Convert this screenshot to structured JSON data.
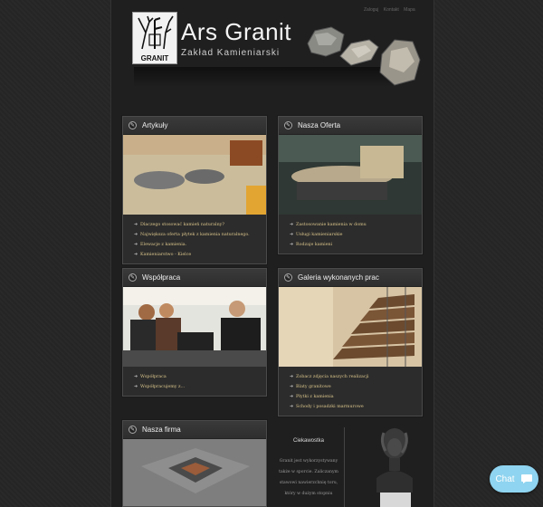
{
  "top_links": [
    "Zaloguj",
    "Kontakt",
    "Mapa"
  ],
  "header": {
    "logo_text": "GRANIT",
    "brand": "Ars Granit",
    "tagline": "Zakład Kamieniarski"
  },
  "cards": {
    "articles": {
      "title": "Artykuły",
      "items": [
        "Dlaczego stosować kamień naturalny?",
        "Największa oferta płytek z kamienia naturalnego.",
        "Elewacje z kamienia.",
        "Kamieniarstwo - Kielce"
      ]
    },
    "offer": {
      "title": "Nasza Oferta",
      "items": [
        "Zastosowanie kamienia w domu",
        "Usługi kamieniarskie",
        "Rodzaje kamieni"
      ]
    },
    "cooperation": {
      "title": "Współpraca",
      "items": [
        "Współpraca",
        "Współpracujemy z..."
      ]
    },
    "gallery": {
      "title": "Galeria wykonanych prac",
      "items": [
        "Zobacz zdjęcia naszych realizacji",
        "Blaty granitowe",
        "Płytki z kamienia",
        "Schody i posadzki marmurowe"
      ]
    },
    "company": {
      "title": "Nasza firma"
    }
  },
  "quote": {
    "title": "Ciekawostka",
    "lines": [
      "Granit jest wykorzystywany",
      "także w sporcie. Zaliczanym",
      "stawowi nawierzchnię toru,",
      "który w dużym stopniu"
    ]
  },
  "chat": {
    "label": "Chat"
  },
  "colors": {
    "background": "#262626",
    "card": "#2c2c2c",
    "link": "#d8c38a",
    "chat": "#8fd4f0"
  }
}
